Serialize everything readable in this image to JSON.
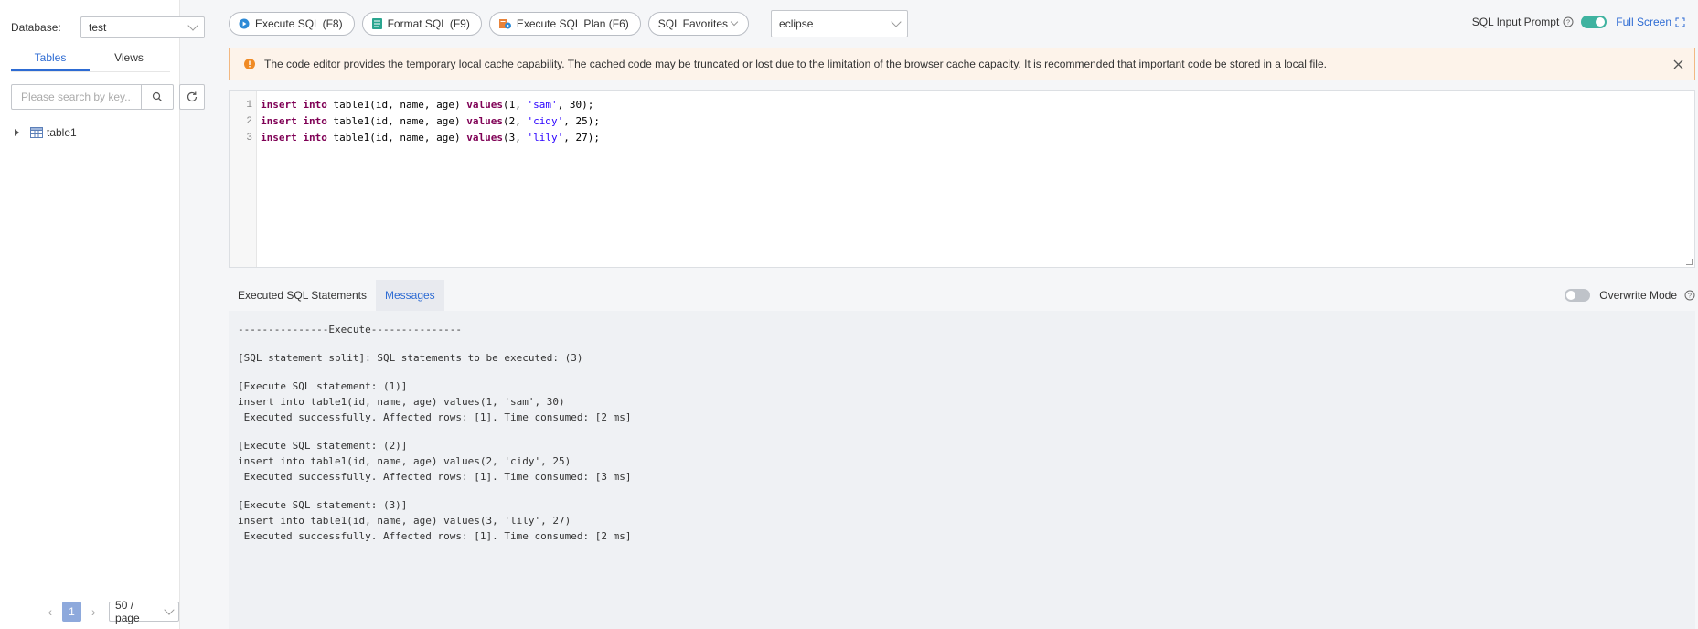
{
  "sidebar": {
    "database_label": "Database:",
    "database_value": "test",
    "tabs": [
      "Tables",
      "Views"
    ],
    "search_placeholder": "Please search by key...",
    "tree_items": [
      "table1"
    ],
    "pagination": {
      "current_page": "1",
      "page_size": "50 / page"
    }
  },
  "toolbar": {
    "execute_sql": "Execute SQL (F8)",
    "format_sql": "Format SQL (F9)",
    "execute_plan": "Execute SQL Plan (F6)",
    "favorites": "SQL Favorites",
    "theme": "eclipse",
    "sql_input_prompt": "SQL Input Prompt",
    "full_screen": "Full Screen"
  },
  "notice": {
    "text": "The code editor provides the temporary local cache capability. The cached code may be truncated or lost due to the limitation of the browser cache capacity. It is recommended that important code be stored in a local file."
  },
  "editor": {
    "line_numbers": [
      "1",
      "2",
      "3"
    ],
    "lines": [
      {
        "kw1": "insert",
        "kw2": "into",
        "t1": " table1(id, name, age) ",
        "kw3": "values",
        "t2": "(1, ",
        "s": "'sam'",
        "t3": ", 30);"
      },
      {
        "kw1": "insert",
        "kw2": "into",
        "t1": " table1(id, name, age) ",
        "kw3": "values",
        "t2": "(2, ",
        "s": "'cidy'",
        "t3": ", 25);"
      },
      {
        "kw1": "insert",
        "kw2": "into",
        "t1": " table1(id, name, age) ",
        "kw3": "values",
        "t2": "(3, ",
        "s": "'lily'",
        "t3": ", 27);"
      }
    ]
  },
  "results": {
    "tabs": [
      "Executed SQL Statements",
      "Messages"
    ],
    "overwrite_mode": "Overwrite Mode",
    "messages": {
      "execute_header": "---------------Execute---------------",
      "split": "[SQL statement split]: SQL statements to be executed: (3)",
      "blocks": [
        {
          "title": "[Execute SQL statement: (1)]",
          "sql": "insert into table1(id, name, age) values(1, 'sam', 30)",
          "result": " Executed successfully. Affected rows: [1]. Time consumed: [2 ms]"
        },
        {
          "title": "[Execute SQL statement: (2)]",
          "sql": "insert into table1(id, name, age) values(2, 'cidy', 25)",
          "result": " Executed successfully. Affected rows: [1]. Time consumed: [3 ms]"
        },
        {
          "title": "[Execute SQL statement: (3)]",
          "sql": "insert into table1(id, name, age) values(3, 'lily', 27)",
          "result": " Executed successfully. Affected rows: [1]. Time consumed: [2 ms]"
        }
      ]
    }
  },
  "colors": {
    "accent": "#2d6bd3",
    "toggle_on": "#3fb3a0",
    "notice_bg": "#fdf3ea",
    "notice_border": "#f2b882",
    "warning_icon": "#f08a24"
  }
}
